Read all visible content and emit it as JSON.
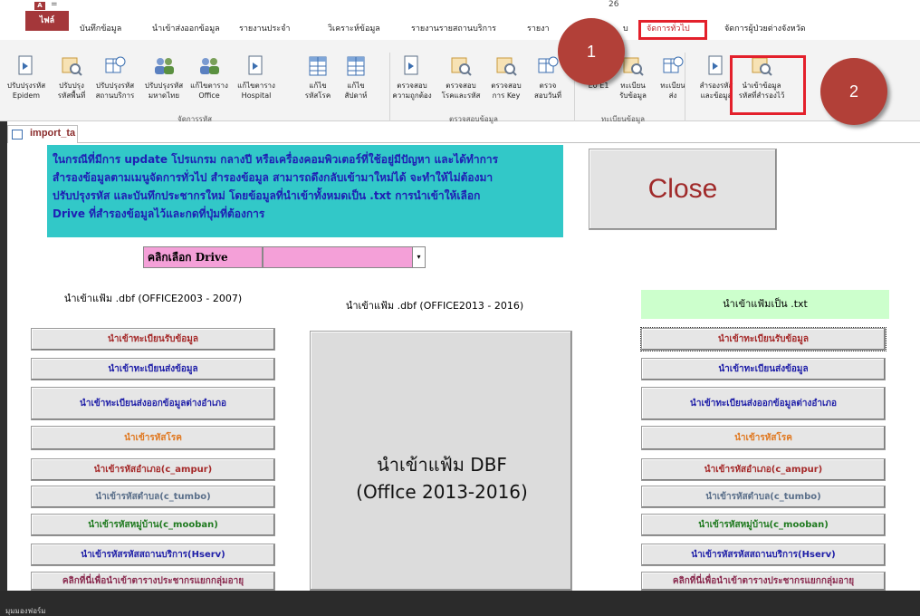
{
  "titlebar": {
    "app_badge": "A",
    "qat": "=",
    "title": "26"
  },
  "ribbon_tabs": [
    {
      "label": "ไฟล์"
    },
    {
      "label": "บันทึกข้อมูล"
    },
    {
      "label": "นำเข้าส่งออกข้อมูล"
    },
    {
      "label": "รายงานประจำ"
    },
    {
      "label": "วิเคราะห์ข้อมูล"
    },
    {
      "label": "รายงานรายสถานบริการ"
    },
    {
      "label": "รายงา"
    },
    {
      "label": "บ"
    },
    {
      "label": "จัดการทั่วไป"
    },
    {
      "label": "จัดการผู้ป่วยต่างจังหวัด"
    }
  ],
  "ribbon_buttons": [
    {
      "icon": "document-arrow-icon",
      "line1": "ปรับปรุงรหัส",
      "line2": "Epidem"
    },
    {
      "icon": "table-search-icon",
      "line1": "ปรับปรุง",
      "line2": "รหัสพื้นที่"
    },
    {
      "icon": "calendar-table-icon",
      "line1": "ปรับปรุงรหัส",
      "line2": "สถานบริการ"
    },
    {
      "icon": "people-icon",
      "line1": "ปรับปรุงรหัส",
      "line2": "มหาดไทย"
    },
    {
      "icon": "people-icon",
      "line1": "แก้ไขตาราง",
      "line2": "Office"
    },
    {
      "icon": "document-arrow-icon",
      "line1": "แก้ไขตาราง",
      "line2": "Hospital"
    },
    {
      "icon": "grid-table-icon",
      "line1": "แก้ไข",
      "line2": "รหัสโรค"
    },
    {
      "icon": "grid-table-icon",
      "line1": "แก้ไข",
      "line2": "สัปดาห์"
    },
    {
      "icon": "document-arrow-icon",
      "line1": "ตรวจสอบ",
      "line2": "ความถูกต้อง"
    },
    {
      "icon": "table-search-icon",
      "line1": "ตรวจสอบ",
      "line2": "โรคและรหัส"
    },
    {
      "icon": "table-search-icon",
      "line1": "ตรวจสอบ",
      "line2": "การ Key"
    },
    {
      "icon": "calendar-table-icon",
      "line1": "ตรวจ",
      "line2": "สอบวันที่"
    },
    {
      "icon": "table-search-icon",
      "line1": "",
      "line2": "E0 E1"
    },
    {
      "icon": "table-search-icon",
      "line1": "ทะเบียน",
      "line2": "รับข้อมูล"
    },
    {
      "icon": "calendar-table-icon",
      "line1": "ทะเบียน",
      "line2": "ส่ง"
    },
    {
      "icon": "document-arrow-icon",
      "line1": "สำรองรหัส",
      "line2": "และข้อมูล"
    },
    {
      "icon": "table-search-icon",
      "line1": "นำเข้าข้อมูล",
      "line2": "รหัสที่สำรองไว้"
    }
  ],
  "ribbon_groups": [
    {
      "label": "จัดการรหัส"
    },
    {
      "label": "ตรวจสอบข้อมูล"
    },
    {
      "label": "ทะเบียนข้อมูล"
    },
    {
      "label": ""
    }
  ],
  "callouts": [
    {
      "label": "1"
    },
    {
      "label": "2"
    }
  ],
  "doc_tab": {
    "label": "import_ta"
  },
  "notice": {
    "line1": "ในกรณีที่มีการ update โปรแกรม กลางปี  หรือเครื่องคอมพิวเตอร์ที่ใช้อยู่มีปัญหา และได้ทำการ",
    "line2": "สำรองข้อมูลตามเมนูจัดการทั่วไป สำรองข้อมูล สามารถดึงกลับเข้ามาใหม่ได้ จะทำให้ไม่ต้องมา",
    "line3": "ปรับปรุงรหัส และบันทึกประชากรใหม่ โดยข้อมูลที่นำเข้าทั้งหมดเป็น .txt การนำเข้าให้เลือก",
    "line4": "Drive ที่สำรองข้อมูลไว้และกดที่ปุ่มที่ต้องการ"
  },
  "close_button": {
    "label": "Close"
  },
  "drive": {
    "label": "คลิกเลือก Drive",
    "value": "",
    "arrow": "▾"
  },
  "columns": {
    "dbf2003": {
      "header": "นำเข้าแฟ้ม .dbf (OFFICE2003 - 2007)",
      "buttons": [
        {
          "label": "นำเข้าทะเบียนรับข้อมูล",
          "color": "#a52a2a"
        },
        {
          "label": "นำเข้าทะเบียนส่งข้อมูล",
          "color": "#1f1fa8"
        },
        {
          "label": "นำเข้าทะเบียนส่งออกข้อมูลต่างอำเภอ",
          "color": "#1f1fa8"
        },
        {
          "label": "นำเข้ารหัสโรค",
          "color": "#e07820"
        },
        {
          "label": "นำเข้ารหัสอำเภอ(c_ampur)",
          "color": "#a52a2a"
        },
        {
          "label": "นำเข้ารหัสตำบล(c_tumbo)",
          "color": "#5a6f8a"
        },
        {
          "label": "นำเข้ารหัสหมู่บ้าน(c_mooban)",
          "color": "#1f7a1f"
        },
        {
          "label": "นำเข้ารหัสรหัสสถานบริการ(Hserv)",
          "color": "#1f1fa8"
        },
        {
          "label": "คลิกที่นี่เพื่อนำเข้าตารางประชากรแยกกลุ่มอายุ",
          "color": "#8a2b4f"
        }
      ]
    },
    "dbf2013": {
      "header": "นำเข้าแฟ้ม .dbf (OFFICE2013 - 2016)",
      "big_line1": "นำเข้าแฟ้ม DBF",
      "big_line2": "(OffIce 2013-2016)"
    },
    "txt": {
      "header": "นำเข้าแฟ้มเป็น .txt",
      "buttons": [
        {
          "label": "นำเข้าทะเบียนรับข้อมูล",
          "color": "#a52a2a"
        },
        {
          "label": "นำเข้าทะเบียนส่งข้อมูล",
          "color": "#1f1fa8"
        },
        {
          "label": "นำเข้าทะเบียนส่งออกข้อมูลต่างอำเภอ",
          "color": "#1f1fa8"
        },
        {
          "label": "นำเข้ารหัสโรค",
          "color": "#e07820"
        },
        {
          "label": "นำเข้ารหัสอำเภอ(c_ampur)",
          "color": "#a52a2a"
        },
        {
          "label": "นำเข้ารหัสตำบล(c_tumbo)",
          "color": "#5a6f8a"
        },
        {
          "label": "นำเข้ารหัสหมู่บ้าน(c_mooban)",
          "color": "#1f7a1f"
        },
        {
          "label": "นำเข้ารหัสรหัสสถานบริการ(Hserv)",
          "color": "#1f1fa8"
        },
        {
          "label": "คลิกที่นี่เพื่อนำเข้าตารางประชากรแยกกลุ่มอายุ",
          "color": "#8a2b4f"
        }
      ]
    }
  },
  "statusbar": {
    "label": "มุมมองฟอร์ม"
  },
  "colors": {
    "accent": "#a4373a",
    "notice_bg": "#32c8c8",
    "highlight": "#e3202b",
    "callout": "#b24038",
    "txt_header_bg": "#ccffcc",
    "drive_bg": "#f4a0d8"
  }
}
